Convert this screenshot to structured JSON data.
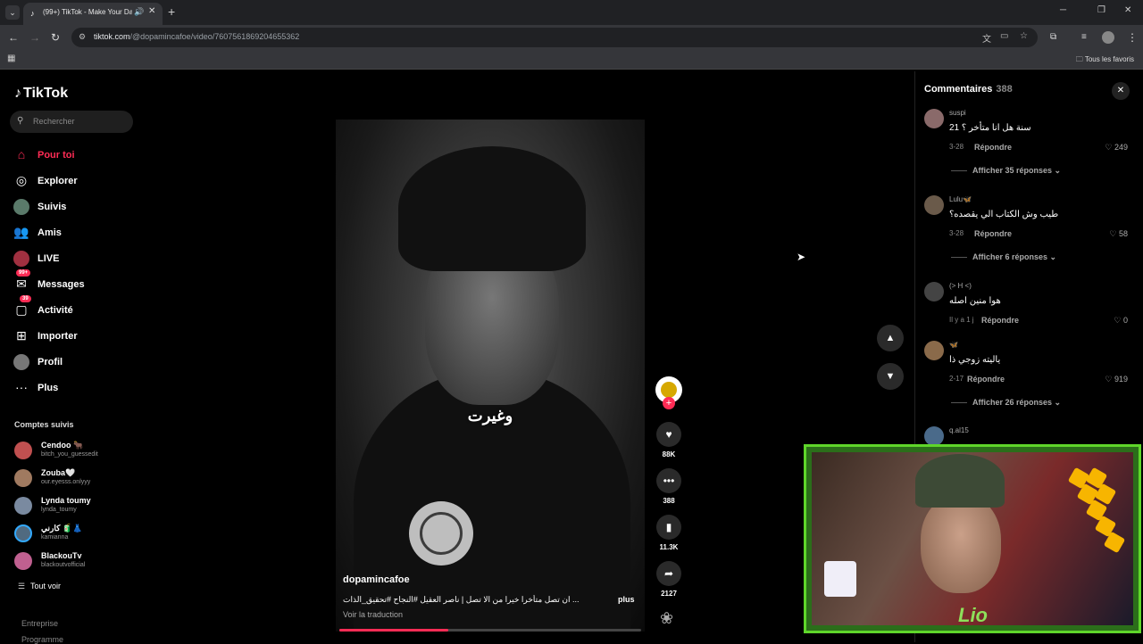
{
  "browser": {
    "tab_title": "(99+) TikTok - Make Your Da",
    "url_host": "tiktok.com",
    "url_path": "/@dopamincafoe/video/7607561869204655362",
    "bookmarks_folder": "Tous les favoris"
  },
  "sidebar": {
    "logo": "TikTok",
    "search_placeholder": "Rechercher",
    "nav": [
      {
        "label": "Pour toi",
        "icon": "home-icon"
      },
      {
        "label": "Explorer",
        "icon": "compass-icon"
      },
      {
        "label": "Suivis",
        "icon": "following-avatar-icon"
      },
      {
        "label": "Amis",
        "icon": "friends-icon"
      },
      {
        "label": "LIVE",
        "icon": "live-icon"
      },
      {
        "label": "Messages",
        "icon": "messages-icon",
        "badge": "99+"
      },
      {
        "label": "Activité",
        "icon": "activity-icon",
        "badge": "39"
      },
      {
        "label": "Importer",
        "icon": "upload-icon"
      },
      {
        "label": "Profil",
        "icon": "profile-icon"
      },
      {
        "label": "Plus",
        "icon": "more-icon"
      }
    ],
    "following_title": "Comptes suivis",
    "following": [
      {
        "name": "Cendoo 🐂",
        "user": "bitch_you_guessedit"
      },
      {
        "name": "Zouba🤍",
        "user": "our.eyesss.onlyyy"
      },
      {
        "name": "Lynda toumy",
        "user": "lynda_toumy"
      },
      {
        "name": "كارني 🧃👗",
        "user": "kamianna"
      },
      {
        "name": "BlackouTv",
        "user": "blackoutvofficial"
      }
    ],
    "see_all": "Tout voir",
    "footer": [
      "Entreprise",
      "Programme"
    ]
  },
  "video": {
    "caption": "وغيرت",
    "username": "dopamincafoe",
    "description": "ان تصل متأخرا خيرا من الا تصل | ناصر العقيل #النجاح #تحقيق_الذات ...",
    "more": "plus",
    "translate": "Voir la traduction",
    "progress": 0.36
  },
  "actions": {
    "likes": "88K",
    "comments": "388",
    "saves": "11.3K",
    "shares": "2127"
  },
  "comments": {
    "title": "Commentaires",
    "count": "388",
    "items": [
      {
        "user": "suspi",
        "text": "سنة هل انا متأخر ؟ 21",
        "date": "3-28",
        "reply": "Répondre",
        "likes": "249",
        "more": "Afficher 35 réponses"
      },
      {
        "user": "Lulu🦋",
        "text": "طيب وش الكتاب الي يقصده؟",
        "date": "3-28",
        "reply": "Répondre",
        "likes": "58",
        "more": "Afficher 6 réponses"
      },
      {
        "user": "(> H <)",
        "text": "هوا منين اصله",
        "date": "Il y a 1 j",
        "reply": "Répondre",
        "likes": "0",
        "more": ""
      },
      {
        "user": "🦋",
        "text": "ياليته زوجي ذا",
        "date": "2-17",
        "reply": "Répondre",
        "likes": "919",
        "more": "Afficher 26 réponses"
      },
      {
        "user": "q.al15",
        "text": "",
        "date": "",
        "reply": "",
        "likes": "",
        "more": ""
      }
    ]
  },
  "colors": {
    "accent": "#fe2c55",
    "webcam_border": "#5fd62a"
  }
}
